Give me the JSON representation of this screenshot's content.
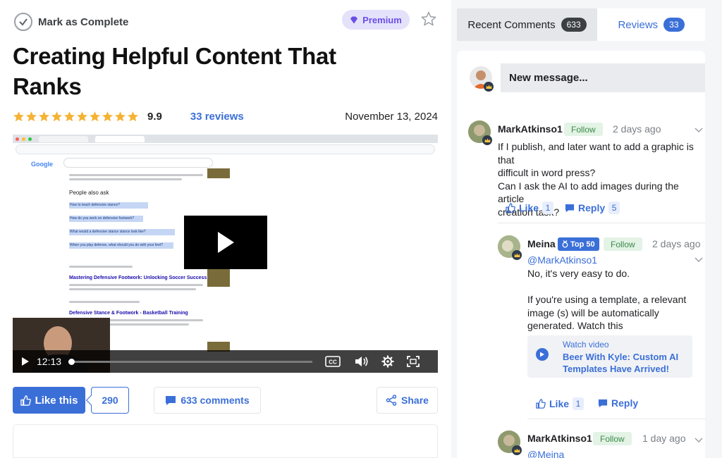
{
  "header": {
    "mark_complete_label": "Mark as Complete",
    "premium_label": "Premium",
    "title": "Creating Helpful Content That Ranks"
  },
  "rating": {
    "stars": 10,
    "value": "9.9",
    "reviews_label": "33 reviews",
    "date": "November 13, 2024"
  },
  "video": {
    "timecode": "12:13",
    "progress_fraction": 0.01,
    "browser": {
      "search_engine": "Google",
      "people_also_ask": "People also ask",
      "questions": [
        "How to teach defensive stance?",
        "How do you work on defensive footwork?",
        "What would a defensive stance stance look like?",
        "When you play defense, what should you do with your feet?"
      ],
      "results": [
        "Mastering Defensive Footwork: Unlocking Soccer Success",
        "Defensive Stance & Footwork - Basketball Training"
      ]
    }
  },
  "actions": {
    "like_label": "Like this",
    "like_count": "290",
    "comments_label": "633 comments",
    "share_label": "Share"
  },
  "sidebar": {
    "tabs": [
      {
        "label": "Recent Comments",
        "count": "633"
      },
      {
        "label": "Reviews",
        "count": "33"
      }
    ],
    "new_message_placeholder": "New message...",
    "comments": [
      {
        "author": "MarkAtkinso1",
        "follow_label": "Follow",
        "time": "2 days ago",
        "text_lines": [
          "If I publish, and later want to add a graphic is that",
          "difficult in word press?",
          "Can I ask the AI to add images during the article",
          "creation task?"
        ],
        "like_label": "Like",
        "like_count": "1",
        "reply_label": "Reply",
        "reply_count": "5"
      },
      {
        "author": "Meina",
        "badge_label": "Top 50",
        "follow_label": "Follow",
        "time": "2 days ago",
        "mention": "@MarkAtkinso1",
        "text_lines": [
          "No, it's very easy to do.",
          "",
          "If you're using a template, a relevant",
          "image (s) will be automatically",
          "generated. Watch this"
        ],
        "watch_label": "Watch video",
        "watch_title": "Beer With Kyle: Custom AI Templates Have Arrived!",
        "like_label": "Like",
        "like_count": "1",
        "reply_label": "Reply"
      },
      {
        "author": "MarkAtkinso1",
        "follow_label": "Follow",
        "time": "1 day ago",
        "mention": "@Meina"
      }
    ]
  },
  "colors": {
    "accent": "#3b6fd8",
    "premium_text": "#6b4ee6",
    "follow_text": "#3b8a4a",
    "star": "#f5b335"
  }
}
